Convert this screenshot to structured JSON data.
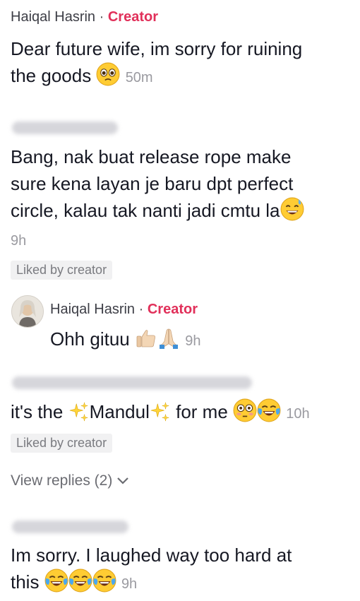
{
  "comments": [
    {
      "author": "Haiqal Hasrin",
      "separator": "·",
      "badge": "Creator",
      "text_line1": "Dear future wife, im sorry for ruining",
      "text_line2": "the goods",
      "time": "50m"
    },
    {
      "text_line1": "Bang, nak buat release rope make",
      "text_line2": "sure kena layan je baru dpt perfect",
      "text_line3": "circle, kalau tak nanti jadi cmtu la",
      "time": "9h",
      "liked_label": "Liked by creator"
    },
    {
      "author": "Haiqal Hasrin",
      "separator": "·",
      "badge": "Creator",
      "text": "Ohh gituu",
      "time": "9h"
    },
    {
      "text_a": "it's the",
      "text_b": "Mandul",
      "text_c": "for me",
      "time": "10h",
      "liked_label": "Liked by creator",
      "view_replies": "View replies (2)"
    },
    {
      "text_line1": "Im sorry. I laughed way too hard at",
      "text_line2": "this",
      "time": "9h"
    }
  ],
  "icons": {
    "pleading": "pleading-face-emoji",
    "sweat": "grinning-sweat-emoji",
    "thumbs": "thumbs-up-emoji",
    "pray": "folded-hands-emoji",
    "sparkles": "sparkles-emoji",
    "flushed": "flushed-face-emoji",
    "joy": "tears-of-joy-emoji"
  },
  "colors": {
    "creator": "#e1305a",
    "muted": "#9a9aa0"
  }
}
